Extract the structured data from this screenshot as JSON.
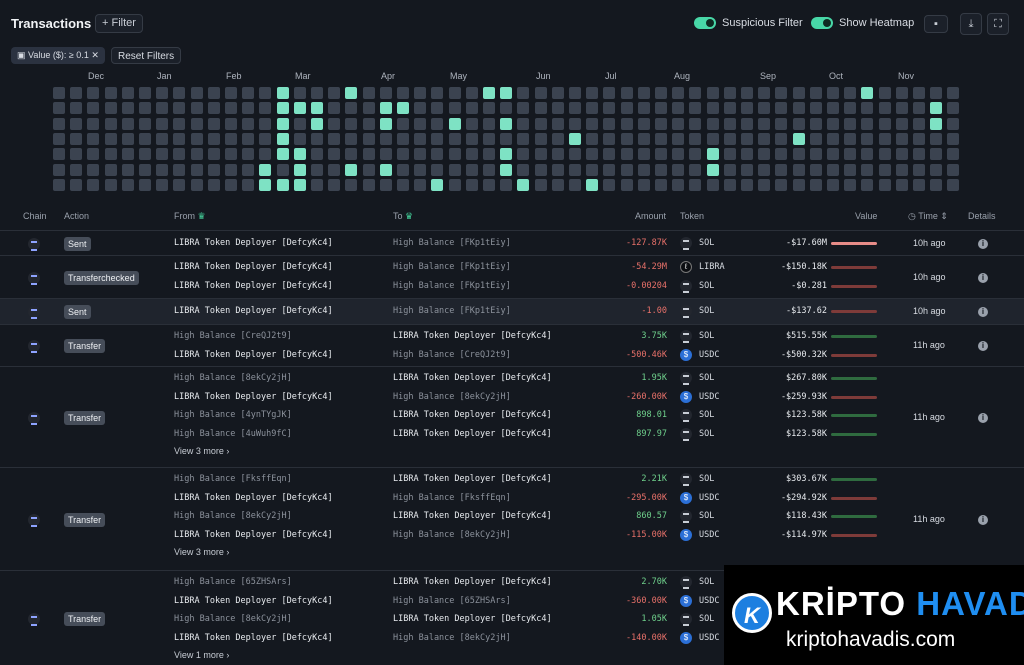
{
  "header": {
    "title": "Transactions",
    "filter_label": "+ Filter",
    "suspicious_label": "Suspicious Filter",
    "heatmap_label": "Show Heatmap"
  },
  "filters": {
    "value_chip": "Value ($): ≥ 0.1",
    "reset_label": "Reset Filters"
  },
  "heatmap": {
    "months": [
      "Dec",
      "Jan",
      "Feb",
      "Mar",
      "Apr",
      "May",
      "Jun",
      "Jul",
      "Aug",
      "Sep",
      "Oct",
      "Nov"
    ],
    "weeks": 53,
    "active_cells": [
      [
        13,
        0
      ],
      [
        17,
        0
      ],
      [
        25,
        0
      ],
      [
        26,
        0
      ],
      [
        47,
        0
      ],
      [
        13,
        1
      ],
      [
        14,
        1
      ],
      [
        15,
        1
      ],
      [
        19,
        1
      ],
      [
        20,
        1
      ],
      [
        51,
        1
      ],
      [
        13,
        2
      ],
      [
        15,
        2
      ],
      [
        19,
        2
      ],
      [
        23,
        2
      ],
      [
        26,
        2
      ],
      [
        51,
        2
      ],
      [
        13,
        3
      ],
      [
        30,
        3
      ],
      [
        43,
        3
      ],
      [
        13,
        4
      ],
      [
        14,
        4
      ],
      [
        26,
        4
      ],
      [
        38,
        4
      ],
      [
        12,
        5
      ],
      [
        14,
        5
      ],
      [
        17,
        5
      ],
      [
        19,
        5
      ],
      [
        26,
        5
      ],
      [
        38,
        5
      ],
      [
        12,
        6
      ],
      [
        13,
        6
      ],
      [
        14,
        6
      ],
      [
        22,
        6
      ],
      [
        27,
        6
      ],
      [
        31,
        6
      ]
    ]
  },
  "table": {
    "columns": {
      "chain": "Chain",
      "action": "Action",
      "from": "From",
      "to": "To",
      "amount": "Amount",
      "token": "Token",
      "value": "Value",
      "time": "Time",
      "details": "Details"
    },
    "groups": [
      {
        "action": "Sent",
        "time": "10h ago",
        "highlight": false,
        "rows": [
          {
            "from": "LIBRA Token Deployer [DefcyKc4]",
            "to": "High Balance [FKp1tEiy]",
            "amount": "-127.87K",
            "token": "SOL",
            "value": "-$17.60M",
            "bar_fraction": 1.0,
            "sign": "neg"
          }
        ]
      },
      {
        "action": "Transferchecked",
        "time": "10h ago",
        "highlight": false,
        "rows": [
          {
            "from": "LIBRA Token Deployer [DefcyKc4]",
            "to": "High Balance [FKp1tEiy]",
            "amount": "-54.29M",
            "token": "LIBRA",
            "value": "-$150.18K",
            "bar_fraction": 1.0,
            "sign": "neg"
          },
          {
            "from": "LIBRA Token Deployer [DefcyKc4]",
            "to": "High Balance [FKp1tEiy]",
            "amount": "-0.00204",
            "token": "SOL",
            "value": "-$0.281",
            "bar_fraction": 1.0,
            "sign": "neg"
          }
        ]
      },
      {
        "action": "Sent",
        "time": "10h ago",
        "highlight": true,
        "rows": [
          {
            "from": "LIBRA Token Deployer [DefcyKc4]",
            "to": "High Balance [FKp1tEiy]",
            "amount": "-1.00",
            "token": "SOL",
            "value": "-$137.62",
            "bar_fraction": 1.0,
            "sign": "neg"
          }
        ]
      },
      {
        "action": "Transfer",
        "time": "11h ago",
        "highlight": false,
        "rows": [
          {
            "from": "High Balance [CreQJ2t9]",
            "to": "LIBRA Token Deployer [DefcyKc4]",
            "amount": "3.75K",
            "token": "SOL",
            "value": "$515.55K",
            "bar_fraction": 1.0,
            "sign": "pos"
          },
          {
            "from": "LIBRA Token Deployer [DefcyKc4]",
            "to": "High Balance [CreQJ2t9]",
            "amount": "-500.46K",
            "token": "USDC",
            "value": "-$500.32K",
            "bar_fraction": 1.0,
            "sign": "neg"
          }
        ]
      },
      {
        "action": "Transfer",
        "time": "11h ago",
        "highlight": false,
        "more": "View 3 more",
        "rows": [
          {
            "from": "High Balance [8ekCy2jH]",
            "to": "LIBRA Token Deployer [DefcyKc4]",
            "amount": "1.95K",
            "token": "SOL",
            "value": "$267.80K",
            "bar_fraction": 1.0,
            "sign": "pos"
          },
          {
            "from": "LIBRA Token Deployer [DefcyKc4]",
            "to": "High Balance [8ekCy2jH]",
            "amount": "-260.00K",
            "token": "USDC",
            "value": "-$259.93K",
            "bar_fraction": 1.0,
            "sign": "neg"
          },
          {
            "from": "High Balance [4ynTYgJK]",
            "to": "LIBRA Token Deployer [DefcyKc4]",
            "amount": "898.01",
            "token": "SOL",
            "value": "$123.58K",
            "bar_fraction": 1.0,
            "sign": "pos"
          },
          {
            "from": "High Balance [4uWuh9fC]",
            "to": "LIBRA Token Deployer [DefcyKc4]",
            "amount": "897.97",
            "token": "SOL",
            "value": "$123.58K",
            "bar_fraction": 1.0,
            "sign": "pos"
          }
        ]
      },
      {
        "action": "Transfer",
        "time": "11h ago",
        "highlight": false,
        "more": "View 3 more",
        "rows": [
          {
            "from": "High Balance [FksffEqn]",
            "to": "LIBRA Token Deployer [DefcyKc4]",
            "amount": "2.21K",
            "token": "SOL",
            "value": "$303.67K",
            "bar_fraction": 1.0,
            "sign": "pos"
          },
          {
            "from": "LIBRA Token Deployer [DefcyKc4]",
            "to": "High Balance [FksffEqn]",
            "amount": "-295.00K",
            "token": "USDC",
            "value": "-$294.92K",
            "bar_fraction": 1.0,
            "sign": "neg"
          },
          {
            "from": "High Balance [8ekCy2jH]",
            "to": "LIBRA Token Deployer [DefcyKc4]",
            "amount": "860.57",
            "token": "SOL",
            "value": "$118.43K",
            "bar_fraction": 1.0,
            "sign": "pos"
          },
          {
            "from": "LIBRA Token Deployer [DefcyKc4]",
            "to": "High Balance [8ekCy2jH]",
            "amount": "-115.00K",
            "token": "USDC",
            "value": "-$114.97K",
            "bar_fraction": 1.0,
            "sign": "neg"
          }
        ]
      },
      {
        "action": "Transfer",
        "time": "",
        "highlight": false,
        "more": "View 1 more",
        "rows": [
          {
            "from": "High Balance [65ZHSArs]",
            "to": "LIBRA Token Deployer [DefcyKc4]",
            "amount": "2.70K",
            "token": "SOL",
            "value": "",
            "bar_fraction": 0,
            "sign": "pos"
          },
          {
            "from": "LIBRA Token Deployer [DefcyKc4]",
            "to": "High Balance [65ZHSArs]",
            "amount": "-360.00K",
            "token": "USDC",
            "value": "",
            "bar_fraction": 0,
            "sign": "neg"
          },
          {
            "from": "High Balance [8ekCy2jH]",
            "to": "LIBRA Token Deployer [DefcyKc4]",
            "amount": "1.05K",
            "token": "SOL",
            "value": "",
            "bar_fraction": 0,
            "sign": "pos"
          },
          {
            "from": "LIBRA Token Deployer [DefcyKc4]",
            "to": "High Balance [8ekCy2jH]",
            "amount": "-140.00K",
            "token": "USDC",
            "value": "",
            "bar_fraction": 0,
            "sign": "neg"
          }
        ]
      }
    ]
  },
  "watermark": {
    "brand_a": "KRİPTO",
    "brand_b": "HAVADİS",
    "url": "kriptohavadis.com"
  }
}
